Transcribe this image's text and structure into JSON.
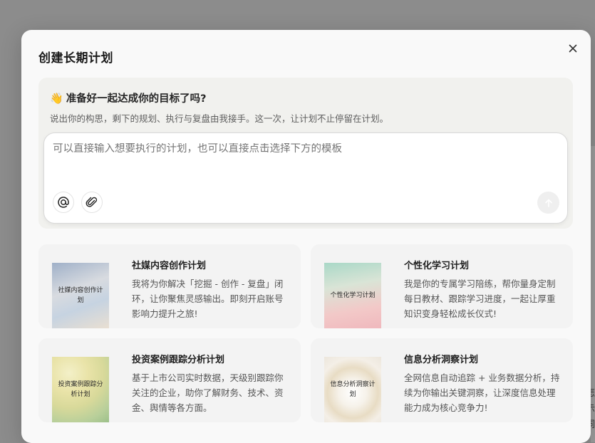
{
  "dialog": {
    "title": "创建长期计划",
    "close_icon": "close-icon"
  },
  "intro": {
    "wave": "👋",
    "heading": "准备好一起达成你的目标了吗?",
    "subtitle": "说出你的构思，剩下的规划、执行与复盘由我接手。这一次，让计划不止停留在计划。"
  },
  "input": {
    "placeholder": "可以直接输入想要执行的计划，也可以直接点击选择下方的模板",
    "value": "",
    "mention_icon": "at-icon",
    "attach_icon": "paperclip-icon",
    "send_icon": "arrow-up-icon"
  },
  "templates": [
    {
      "title": "社媒内容创作计划",
      "desc": "我将为你解决「挖掘 - 创作 - 复盘」闭环，让你聚焦灵感输出。即刻开启账号影响力提升之旅!",
      "thumb_label": "社媒内容创作计划"
    },
    {
      "title": "个性化学习计划",
      "desc": "我是你的专属学习陪练，帮你量身定制每日教材、跟踪学习进度，一起让厚重知识变身轻松成长仪式!",
      "thumb_label": "个性化学习计划"
    },
    {
      "title": "投资案例跟踪分析计划",
      "desc": "基于上市公司实时数据，天级别跟踪你关注的企业，助你了解财务、技术、资金、舆情等各方面。",
      "thumb_label": "投资案例跟踪分析计划"
    },
    {
      "title": "信息分析洞察计划",
      "desc": "全网信息自动追踪 + 业务数据分析，持续为你输出关键洞察，让深度信息处理能力成为核心竞争力!",
      "thumb_label": "信息分析洞察计划"
    }
  ],
  "backdrop_glyphs": [
    "怎",
    "示",
    "词"
  ]
}
